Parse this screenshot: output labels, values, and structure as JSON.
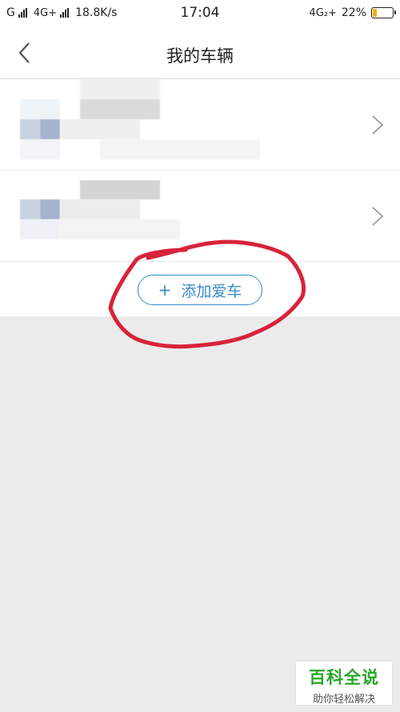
{
  "status_bar": {
    "left_text_1": "G",
    "left_text_2": "4G+",
    "speed": "18.8K/s",
    "time": "17:04",
    "network_right": "4G₂+",
    "battery_percent": "22%",
    "battery_level": 0.22
  },
  "nav": {
    "title": "我的车辆"
  },
  "vehicles": [
    {
      "label": ""
    },
    {
      "label": ""
    }
  ],
  "add_button": {
    "icon": "+",
    "label": "添加爱车"
  },
  "colors": {
    "accent": "#3a8bc4",
    "annotation": "#d8233a",
    "background": "#ebebeb"
  },
  "watermark": {
    "title": "百科全说",
    "subtitle": "助你轻松解决"
  }
}
